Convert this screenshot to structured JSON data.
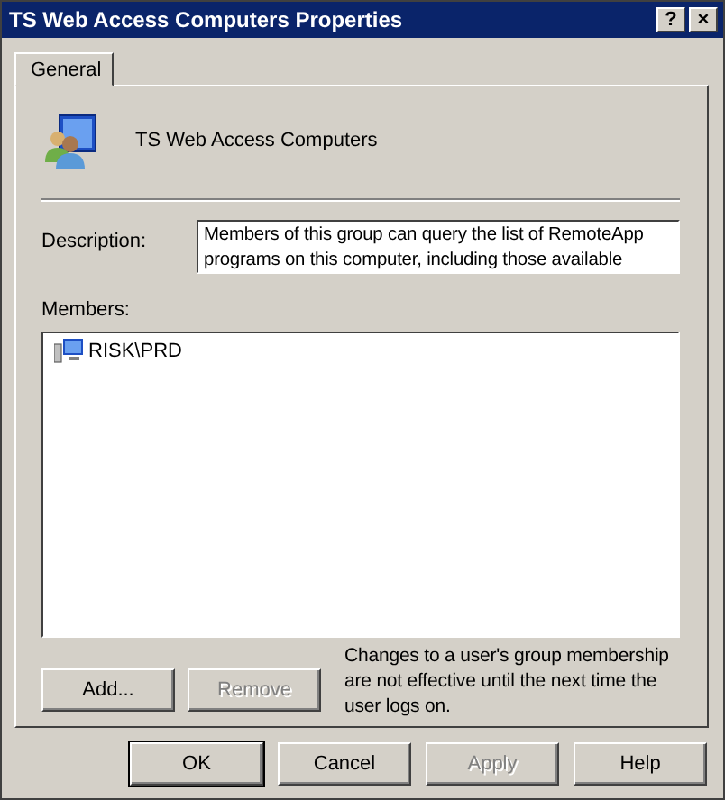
{
  "window": {
    "title": "TS Web Access Computers Properties",
    "title_buttons": [
      "?",
      "×"
    ]
  },
  "tabs": [
    {
      "label": "General",
      "selected": true
    }
  ],
  "group_name": "TS Web Access Computers",
  "description": {
    "label": "Description:",
    "lines": [
      "Members of this group can query the list of RemoteApp",
      "programs on this computer, including those available"
    ]
  },
  "members": {
    "label": "Members:",
    "items": [
      {
        "name": "RISK\\PRD",
        "selected": false
      }
    ]
  },
  "member_buttons": [
    {
      "label": "Add...",
      "disabled": false
    },
    {
      "label": "Remove",
      "disabled": true
    }
  ],
  "note": [
    "Changes to a user's group membership",
    "are not effective until the next time the",
    "user logs on."
  ],
  "buttons": [
    {
      "label": "OK",
      "disabled": false,
      "default": true
    },
    {
      "label": "Cancel",
      "disabled": false,
      "default": false
    },
    {
      "label": "Apply",
      "disabled": true,
      "default": false
    },
    {
      "label": "Help",
      "disabled": false,
      "default": false
    }
  ]
}
